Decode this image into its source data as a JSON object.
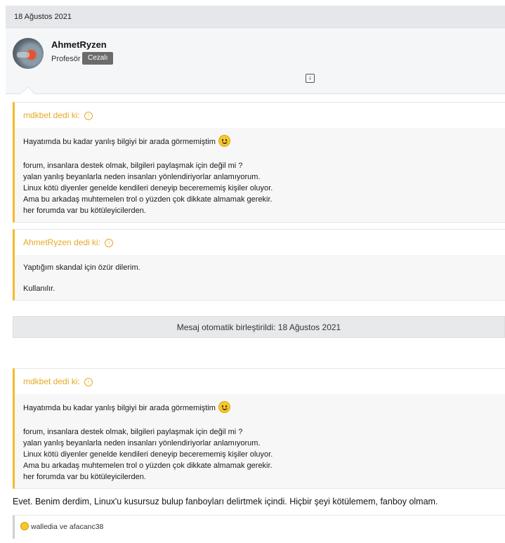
{
  "post": {
    "date": "18 Ağustos 2021",
    "author": "AhmetRyzen",
    "role": "Profesör",
    "badge": "Cezalı"
  },
  "quotes": [
    {
      "author_line": "mdkbet dedi ki:",
      "lines": [
        "Hayatımda bu kadar yanlış bilgiyi bir arada görmemiştim",
        "forum, insanlara destek olmak, bilgileri paylaşmak için değil mi ?",
        "yalan yanlış beyanlarla neden insanları yönlendiriyorlar anlamıyorum.",
        "Linux kötü diyenler genelde kendileri deneyip becerememiş kişiler oluyor.",
        "Ama bu arkadaş muhtemelen trol o yüzden çok dikkate almamak gerekir.",
        "her forumda var bu kötüleyicilerden."
      ]
    },
    {
      "author_line": "AhmetRyzen dedi ki:",
      "lines": [
        "Yaptığım skandal için özür dilerim.",
        "Kullanılır."
      ]
    },
    {
      "author_line": "mdkbet dedi ki:",
      "lines": [
        "Hayatımda bu kadar yanlış bilgiyi bir arada görmemiştim",
        "forum, insanlara destek olmak, bilgileri paylaşmak için değil mi ?",
        "yalan yanlış beyanlarla neden insanları yönlendiriyorlar anlamıyorum.",
        "Linux kötü diyenler genelde kendileri deneyip becerememiş kişiler oluyor.",
        "Ama bu arkadaş muhtemelen trol o yüzden çok dikkate almamak gerekir.",
        "her forumda var bu kötüleyicilerden."
      ]
    }
  ],
  "merged_notice": "Mesaj otomatik birleştirildi: 18 Ağustos 2021",
  "reply_text": "Evet. Benim derdim, Linux'u kusursuz bulup fanboyları delirtmek içindi. Hiçbir şeyi kötülemem, fanboy olmam.",
  "reactions": "walledia ve afacanc38",
  "icons": {
    "download": "download-icon",
    "up": "arrow-up-circle-icon",
    "smiley": "smiley-icon",
    "reaction": "laugh-reaction-icon"
  },
  "colors": {
    "quote_accent": "#f7b92a",
    "badge_bg": "#6b6b6b"
  }
}
